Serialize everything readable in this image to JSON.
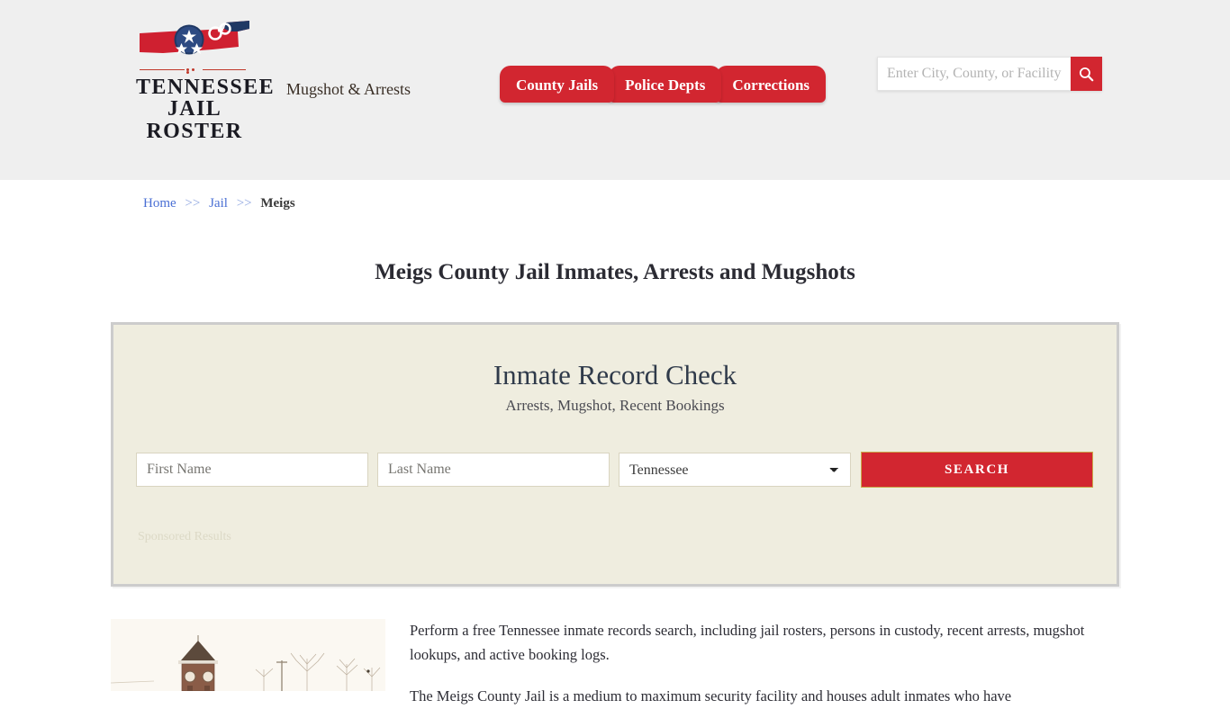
{
  "header": {
    "logo": {
      "word1": "TENNESSEE",
      "word2": "JAIL ROSTER",
      "icon": "tennessee-state-outline-with-tri-star-and-handcuffs"
    },
    "tagline": "Mugshot & Arrests",
    "nav": [
      {
        "label": "County Jails"
      },
      {
        "label": "Police Depts"
      },
      {
        "label": "Corrections"
      }
    ],
    "search": {
      "placeholder": "Enter City, County, or Facility",
      "value": "",
      "icon": "search-icon"
    },
    "colors": {
      "background": "#efefef",
      "accent_red": "#d22630"
    }
  },
  "breadcrumb": {
    "items": [
      {
        "label": "Home",
        "current": false
      },
      {
        "label": "Jail",
        "current": false
      },
      {
        "label": "Meigs",
        "current": true
      }
    ],
    "separator": ">>"
  },
  "page_title": "Meigs County Jail Inmates, Arrests and Mugshots",
  "record_check": {
    "title": "Inmate Record Check",
    "subtitle": "Arrests, Mugshot, Recent Bookings",
    "first_name": {
      "placeholder": "First Name",
      "value": ""
    },
    "last_name": {
      "placeholder": "Last Name",
      "value": ""
    },
    "state": {
      "selected": "Tennessee",
      "options": [
        "Tennessee"
      ]
    },
    "search_button": "SEARCH",
    "sponsored_label": "Sponsored Results",
    "colors": {
      "panel_background": "#efeddf",
      "panel_border": "#cccccc",
      "button": "#d22630"
    }
  },
  "content": {
    "image_alt": "meigs-county-courthouse-clock-tower-winter",
    "paragraphs": [
      "Perform a free Tennessee inmate records search, including jail rosters, persons in custody, recent arrests, mugshot lookups, and active booking logs.",
      "The Meigs County Jail is a medium to maximum security facility and houses adult inmates who have"
    ]
  }
}
